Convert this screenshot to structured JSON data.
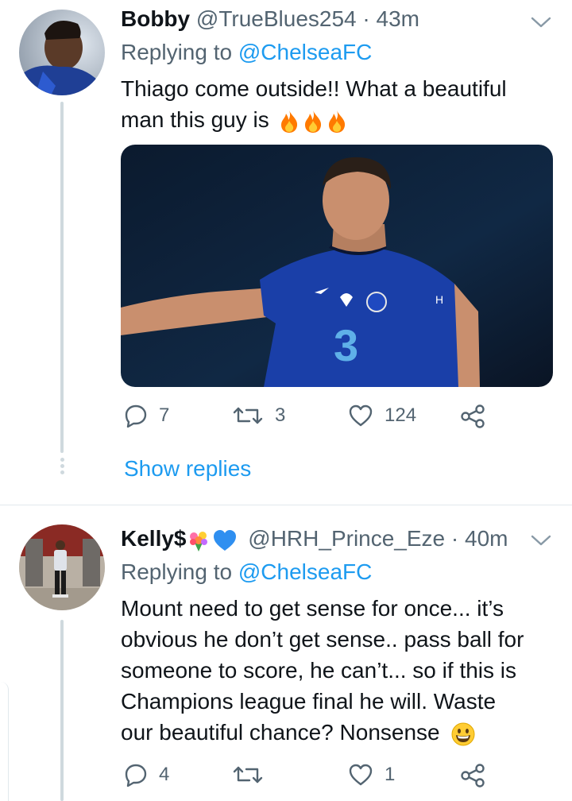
{
  "tweets": [
    {
      "name": "Bobby",
      "handle": "@TrueBlues254",
      "time": "43m",
      "replying_prefix": "Replying to",
      "replying_to": "@ChelseaFC",
      "text_line1": "Thiago come outside!! What a beautiful",
      "text_line2": "man this guy is",
      "emojis": [
        "fire-emoji",
        "fire-emoji",
        "fire-emoji"
      ],
      "replies": "7",
      "retweets": "3",
      "likes": "124",
      "show_replies": "Show replies"
    },
    {
      "name": "Kelly$",
      "name_emojis": [
        "bouquet-emoji",
        "blue-heart-emoji"
      ],
      "handle": "@HRH_Prince_Eze",
      "time": "40m",
      "replying_prefix": "Replying to",
      "replying_to": "@ChelseaFC",
      "text_lines": [
        "Mount need to get sense for once... it’s",
        "obvious he don’t get sense.. pass ball for",
        "someone to score, he can’t... so if this is",
        "Champions league final he will. Waste",
        "our beautiful chance? Nonsense"
      ],
      "text_emoji": "grinning-face-emoji",
      "replies": "4",
      "retweets": "",
      "likes": "1"
    }
  ],
  "colors": {
    "link": "#1d9bf0",
    "secondary": "#536471",
    "kit_blue": "#1a3fa8"
  }
}
